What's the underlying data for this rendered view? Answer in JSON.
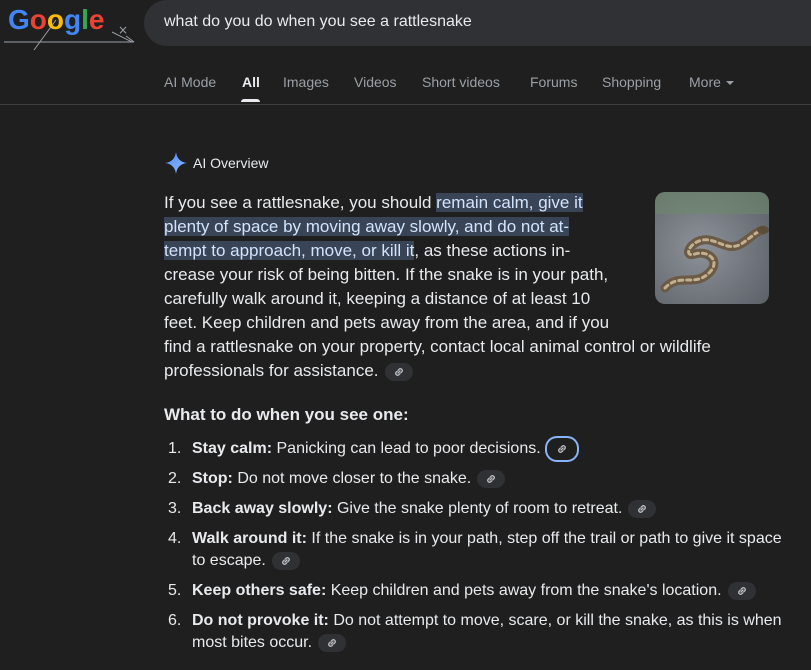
{
  "logo": {
    "letters": [
      "G",
      "o",
      "o",
      "g",
      "l",
      "e"
    ],
    "colors": [
      "#4285f4",
      "#ea4335",
      "#fbbc05",
      "#4285f4",
      "#34a853",
      "#ea4335"
    ]
  },
  "search": {
    "query": "what do you do when you see a rattlesnake"
  },
  "tabs": [
    "AI Mode",
    "All",
    "Images",
    "Videos",
    "Short videos",
    "Forums",
    "Shopping",
    "More"
  ],
  "overview": {
    "title": "AI Overview",
    "lines": [
      {
        "plain": "If you see a rattlesnake, you should ",
        "hl": "remain calm, give it"
      },
      {
        "hl": "plenty of space by moving away slowly, and do not at-"
      },
      {
        "hl": "tempt to approach, move, or kill it",
        "plain": ", as these actions in-"
      },
      {
        "plain": "crease your risk of being bitten. If the snake is in your path,"
      },
      {
        "plain": "carefully walk around it, keeping a distance of at least 10"
      },
      {
        "plain": "feet. Keep children and pets away from the area, and if you"
      },
      {
        "plain": "find a rattlesnake on your property, contact local animal control or wildlife"
      },
      {
        "plain": "professionals for assistance."
      }
    ]
  },
  "subheading": "What to do when you see one:",
  "steps": [
    {
      "num": "1.",
      "bold": "Stay calm:",
      "text": " Panicking can lead to poor decisions."
    },
    {
      "num": "2.",
      "bold": "Stop:",
      "text": " Do not move closer to the snake."
    },
    {
      "num": "3.",
      "bold": "Back away slowly:",
      "text": " Give the snake plenty of room to retreat."
    },
    {
      "num": "4.",
      "bold": "Walk around it:",
      "text": " If the snake is in your path, step off the trail or path to give it space to escape."
    },
    {
      "num": "5.",
      "bold": "Keep others safe:",
      "text": " Keep children and pets away from the snake's location."
    },
    {
      "num": "6.",
      "bold": "Do not provoke it:",
      "text": " Do not attempt to move, scare, or kill the snake, as this is when most bites occur."
    }
  ],
  "colors": {
    "background": "#1f1f1f",
    "highlight": "#394457",
    "link_focus": "#8ab4f8",
    "sparkle": "#4f8df7"
  }
}
